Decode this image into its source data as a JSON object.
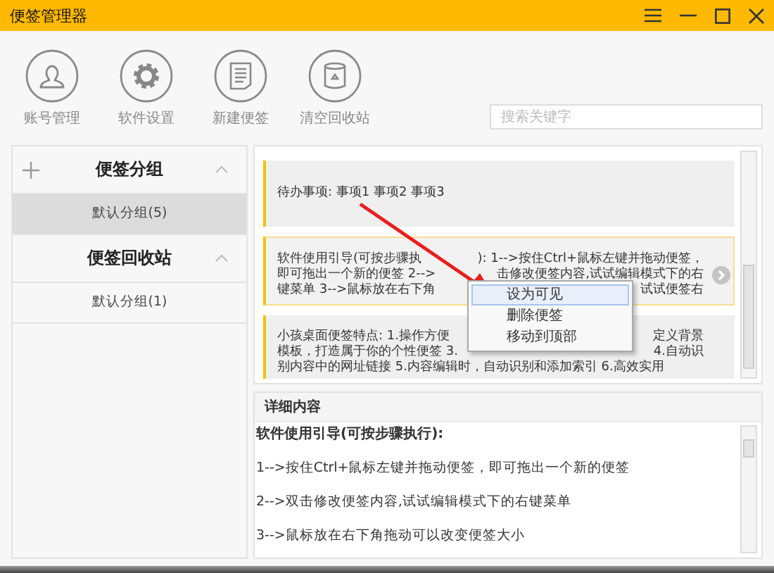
{
  "window": {
    "title": "便签管理器"
  },
  "toolbar": [
    {
      "label": "账号管理",
      "kind": "user"
    },
    {
      "label": "软件设置",
      "kind": "gear"
    },
    {
      "label": "新建便签",
      "kind": "note"
    },
    {
      "label": "清空回收站",
      "kind": "trash"
    }
  ],
  "search": {
    "placeholder": "搜索关键字"
  },
  "sidebar": [
    {
      "title": "便签分组",
      "addable": true,
      "expanded": true,
      "items": [
        {
          "label": "默认分组(5)",
          "selected": true
        }
      ]
    },
    {
      "title": "便签回收站",
      "addable": false,
      "expanded": true,
      "items": [
        {
          "label": "默认分组(1)",
          "selected": false
        }
      ]
    }
  ],
  "notes": [
    {
      "selected": false,
      "lines": [
        [
          "待办事项:  事项1 事项2 事项3"
        ]
      ]
    },
    {
      "selected": true,
      "lines": [
        [
          "软件使用引导(可按步骤执",
          "): 1-->按住Ctrl+鼠标左键并拖动便签，"
        ],
        [
          "即可拖出一个新的便签  2-->",
          "击修改便签内容,试试编辑模式下的右"
        ],
        [
          "键菜单  3-->鼠标放在右下角",
          "试试便签右"
        ]
      ]
    },
    {
      "selected": false,
      "lines": [
        [
          "小孩桌面便签特点: 1.操作方便",
          "定义背景"
        ],
        [
          "模板，打造属于你的个性便签 3.",
          "4.自动识"
        ],
        [
          "别内容中的网址链接 5.内容编辑时，自动识别和添加索引 6.高效实用"
        ]
      ]
    }
  ],
  "context_menu": [
    {
      "label": "设为可见",
      "selected": true
    },
    {
      "label": "删除便签",
      "selected": false
    },
    {
      "label": "移动到顶部",
      "selected": false
    }
  ],
  "detail": {
    "header": "详细内容",
    "title": "软件使用引导(可按步骤执行):",
    "lines": [
      "1-->按住Ctrl+鼠标左键并拖动便签，即可拖出一个新的便签",
      "2-->双击修改便签内容,试试编辑模式下的右键菜单",
      "3-->鼠标放在右下角拖动可以改变便签大小"
    ]
  }
}
